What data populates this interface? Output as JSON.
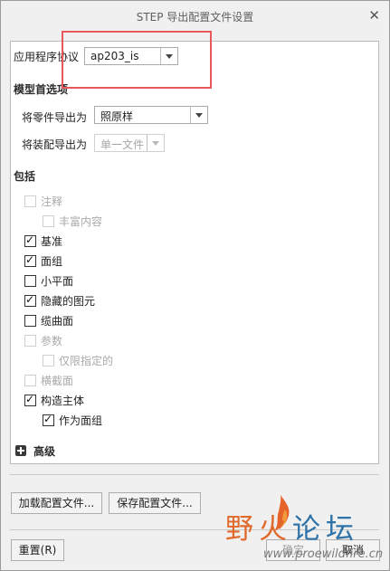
{
  "dialog": {
    "title": "STEP 导出配置文件设置",
    "close_icon": "close-icon"
  },
  "protocol": {
    "label": "应用程序协议",
    "value": "ap203_is"
  },
  "model_options": {
    "heading": "模型首选项",
    "part_export": {
      "label": "将零件导出为",
      "value": "照原样"
    },
    "assembly_export": {
      "label": "将装配导出为",
      "value": "单一文件",
      "disabled": true
    }
  },
  "include": {
    "heading": "包括",
    "items": [
      {
        "label": "注释",
        "checked": false,
        "disabled": true
      },
      {
        "label": "丰富内容",
        "checked": false,
        "disabled": true
      },
      {
        "label": "基准",
        "checked": true,
        "disabled": false
      },
      {
        "label": "面组",
        "checked": true,
        "disabled": false
      },
      {
        "label": "小平面",
        "checked": false,
        "disabled": false
      },
      {
        "label": "隐藏的图元",
        "checked": true,
        "disabled": false
      },
      {
        "label": "缆曲面",
        "checked": false,
        "disabled": false
      },
      {
        "label": "参数",
        "checked": false,
        "disabled": true
      },
      {
        "label": "仅限指定的",
        "checked": false,
        "disabled": true
      },
      {
        "label": "横截面",
        "checked": false,
        "disabled": true
      },
      {
        "label": "构造主体",
        "checked": true,
        "disabled": false
      },
      {
        "label": "作为面组",
        "checked": true,
        "disabled": false
      }
    ]
  },
  "advanced": {
    "label": "高级"
  },
  "buttons": {
    "load_config": "加载配置文件...",
    "save_config": "保存配置文件...",
    "reset": "重置(R)",
    "ok": "确定",
    "cancel": "取消"
  },
  "watermark": {
    "text_a": "野火",
    "text_b": "论坛",
    "url": "www.proewildfire.cn"
  }
}
